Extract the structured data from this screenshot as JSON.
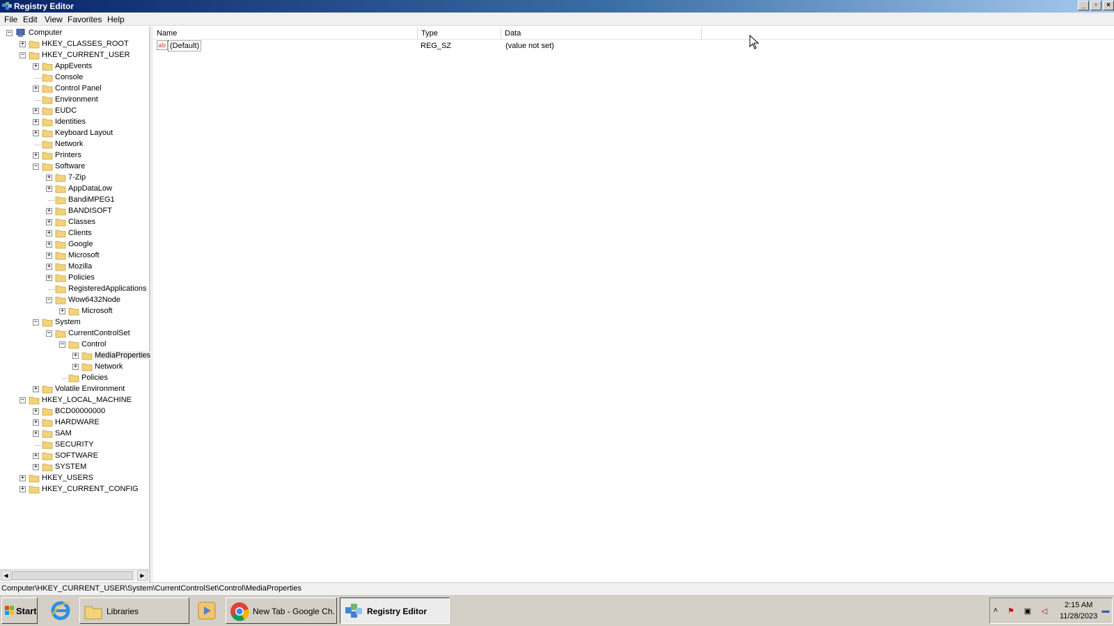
{
  "window": {
    "title": "Registry Editor"
  },
  "menu": [
    "File",
    "Edit",
    "View",
    "Favorites",
    "Help"
  ],
  "tree": [
    {
      "label": "Computer",
      "level": 0,
      "expander": "minus",
      "icon": "computer-icon"
    },
    {
      "label": "HKEY_CLASSES_ROOT",
      "level": 1,
      "expander": "plus"
    },
    {
      "label": "HKEY_CURRENT_USER",
      "level": 1,
      "expander": "minus"
    },
    {
      "label": "AppEvents",
      "level": 2,
      "expander": "plus"
    },
    {
      "label": "Console",
      "level": 2,
      "expander": ""
    },
    {
      "label": "Control Panel",
      "level": 2,
      "expander": "plus"
    },
    {
      "label": "Environment",
      "level": 2,
      "expander": ""
    },
    {
      "label": "EUDC",
      "level": 2,
      "expander": "plus"
    },
    {
      "label": "Identities",
      "level": 2,
      "expander": "plus"
    },
    {
      "label": "Keyboard Layout",
      "level": 2,
      "expander": "plus"
    },
    {
      "label": "Network",
      "level": 2,
      "expander": ""
    },
    {
      "label": "Printers",
      "level": 2,
      "expander": "plus"
    },
    {
      "label": "Software",
      "level": 2,
      "expander": "minus"
    },
    {
      "label": "7-Zip",
      "level": 3,
      "expander": "plus"
    },
    {
      "label": "AppDataLow",
      "level": 3,
      "expander": "plus"
    },
    {
      "label": "BandiMPEG1",
      "level": 3,
      "expander": ""
    },
    {
      "label": "BANDISOFT",
      "level": 3,
      "expander": "plus"
    },
    {
      "label": "Classes",
      "level": 3,
      "expander": "plus"
    },
    {
      "label": "Clients",
      "level": 3,
      "expander": "plus"
    },
    {
      "label": "Google",
      "level": 3,
      "expander": "plus"
    },
    {
      "label": "Microsoft",
      "level": 3,
      "expander": "plus"
    },
    {
      "label": "Mozilla",
      "level": 3,
      "expander": "plus"
    },
    {
      "label": "Policies",
      "level": 3,
      "expander": "plus"
    },
    {
      "label": "RegisteredApplications",
      "level": 3,
      "expander": ""
    },
    {
      "label": "Wow6432Node",
      "level": 3,
      "expander": "minus"
    },
    {
      "label": "Microsoft",
      "level": 4,
      "expander": "plus"
    },
    {
      "label": "System",
      "level": 2,
      "expander": "minus"
    },
    {
      "label": "CurrentControlSet",
      "level": 3,
      "expander": "minus"
    },
    {
      "label": "Control",
      "level": 4,
      "expander": "minus"
    },
    {
      "label": "MediaProperties",
      "level": 5,
      "expander": "plus",
      "selected": true
    },
    {
      "label": "Network",
      "level": 5,
      "expander": "plus"
    },
    {
      "label": "Policies",
      "level": 4,
      "expander": ""
    },
    {
      "label": "Volatile Environment",
      "level": 2,
      "expander": "plus"
    },
    {
      "label": "HKEY_LOCAL_MACHINE",
      "level": 1,
      "expander": "minus"
    },
    {
      "label": "BCD00000000",
      "level": 2,
      "expander": "plus"
    },
    {
      "label": "HARDWARE",
      "level": 2,
      "expander": "plus"
    },
    {
      "label": "SAM",
      "level": 2,
      "expander": "plus"
    },
    {
      "label": "SECURITY",
      "level": 2,
      "expander": ""
    },
    {
      "label": "SOFTWARE",
      "level": 2,
      "expander": "plus"
    },
    {
      "label": "SYSTEM",
      "level": 2,
      "expander": "plus"
    },
    {
      "label": "HKEY_USERS",
      "level": 1,
      "expander": "plus"
    },
    {
      "label": "HKEY_CURRENT_CONFIG",
      "level": 1,
      "expander": "plus"
    }
  ],
  "list": {
    "columns": [
      "Name",
      "Type",
      "Data"
    ],
    "rows": [
      {
        "name": "(Default)",
        "type": "REG_SZ",
        "data": "(value not set)",
        "icon": "string-value-icon"
      }
    ]
  },
  "status": {
    "path": "Computer\\HKEY_CURRENT_USER\\System\\CurrentControlSet\\Control\\MediaProperties"
  },
  "taskbar": {
    "start_label": "Start",
    "buttons": [
      {
        "label": "Libraries",
        "icon": "folder-icon"
      },
      {
        "label": "New Tab - Google Ch...",
        "icon": "chrome-icon"
      },
      {
        "label": "Registry Editor",
        "icon": "regedit-icon",
        "active": true
      }
    ],
    "clock": {
      "time": "2:15 AM",
      "date": "11/28/2023"
    }
  },
  "colors": {
    "titlebar_start": "#0a246a",
    "titlebar_end": "#a6caf0",
    "folder": "#f2d27a",
    "taskbar": "#d4d0c8"
  }
}
